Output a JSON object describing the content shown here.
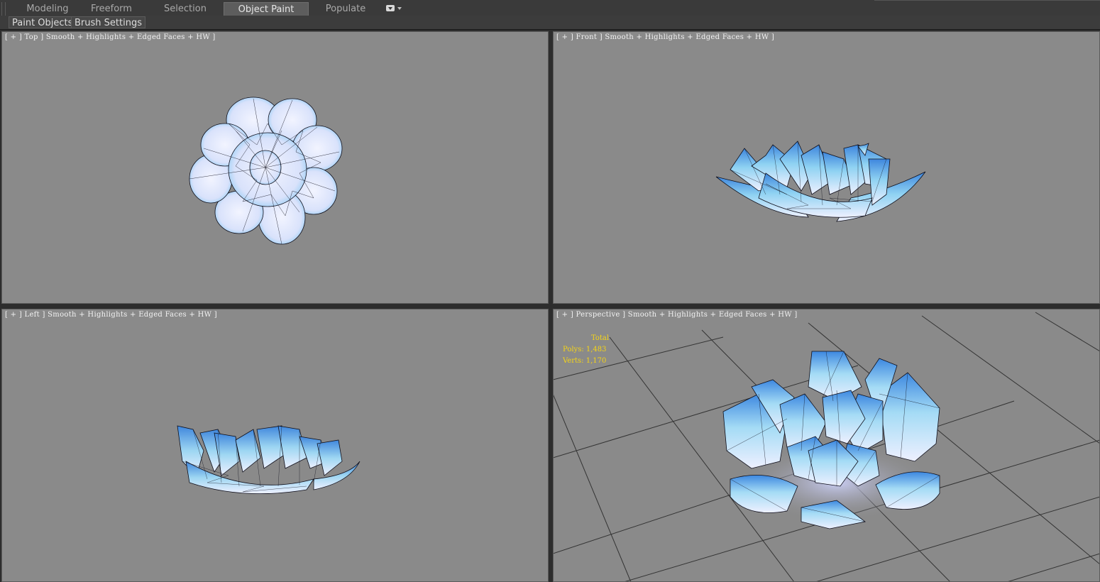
{
  "ribbon": {
    "tabs": [
      {
        "label": "Modeling"
      },
      {
        "label": "Freeform"
      },
      {
        "label": "Selection"
      },
      {
        "label": "Object Paint",
        "active": true
      },
      {
        "label": "Populate"
      }
    ]
  },
  "subbar": {
    "paint_objects": "Paint Objects",
    "brush_settings": "Brush Settings"
  },
  "viewports": {
    "top": {
      "label": "[ + ] Top ] Smooth + Highlights + Edged Faces + HW ]"
    },
    "front": {
      "label": "[ + ] Front ] Smooth + Highlights + Edged Faces + HW ]"
    },
    "left": {
      "label": "[ + ] Left ] Smooth + Highlights + Edged Faces + HW ]"
    },
    "perspective": {
      "label": "[ + ] Perspective ] Smooth + Highlights + Edged Faces + HW ]",
      "stats": {
        "total": "Total",
        "polys": "Polys: 1,483",
        "verts": "Verts: 1,170"
      }
    }
  },
  "colors": {
    "viewport_bg": "#8a8a8a",
    "stats_text": "#f5d417",
    "petal_light": "#eef2ff",
    "petal_blue": "#4aa3e6"
  }
}
